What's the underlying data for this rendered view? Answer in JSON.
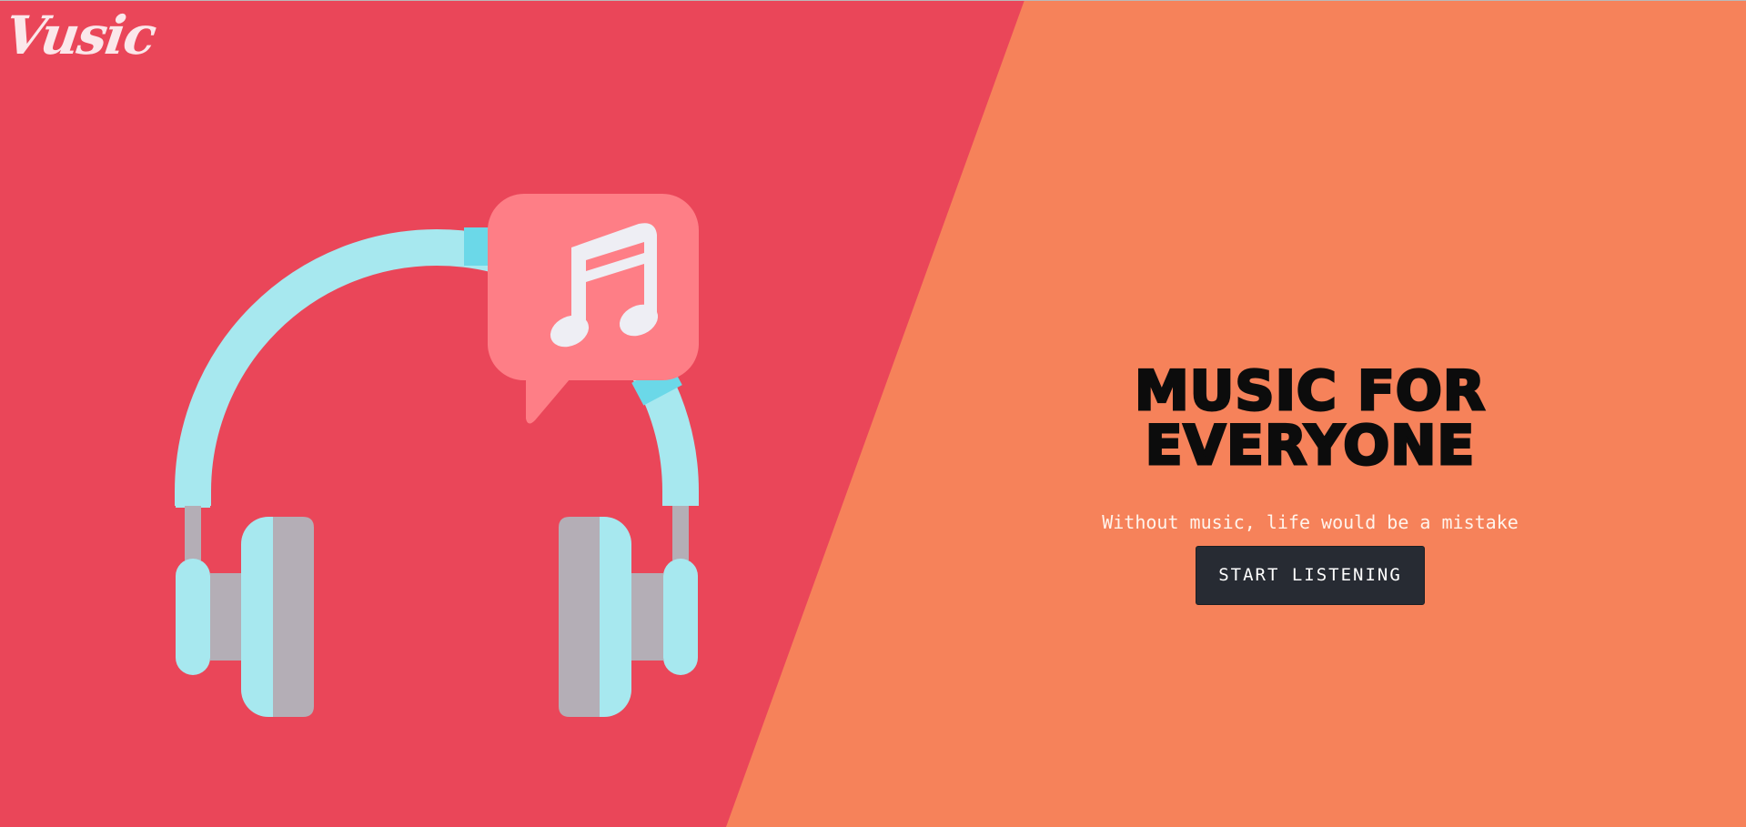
{
  "brand": {
    "logo_text": "Vusic"
  },
  "hero": {
    "title": "MUSIC FOR EVERYONE",
    "subtitle": "Without music, life would be a mistake",
    "cta_label": "START LISTENING"
  },
  "illustration": {
    "icon": "headphones-icon",
    "badge_icon": "music-note-icon"
  },
  "colors": {
    "left_panel": "#ea4659",
    "right_panel": "#f6825a",
    "headphone_band": "#a7e8ef",
    "headphone_accent": "#6bd8e8",
    "headphone_grey": "#b4aeb6",
    "bubble": "#fe7e86",
    "note": "#eeeef4",
    "button": "#272b33"
  }
}
